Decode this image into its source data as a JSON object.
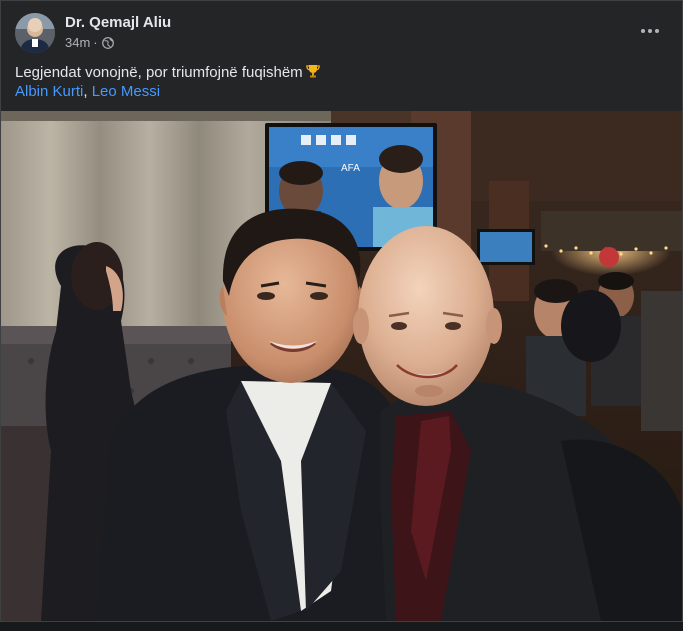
{
  "post": {
    "author": "Dr. Qemajl Aliu",
    "time": "34m",
    "dot": "·",
    "privacy_icon": "globe-icon",
    "more_icon": "more-options-icon",
    "text": "Legjendat vonojnë, por triumfojnë fuqishëm",
    "emoji": "trophy-icon",
    "tags": {
      "first": "Albin Kurti",
      "separator": ", ",
      "second": "Leo Messi"
    }
  },
  "photo": {
    "tv_badge": "AFA"
  },
  "colors": {
    "background": "#18191a",
    "card": "#242526",
    "text_primary": "#e4e6eb",
    "text_secondary": "#b0b3b8",
    "link": "#4599ff"
  }
}
